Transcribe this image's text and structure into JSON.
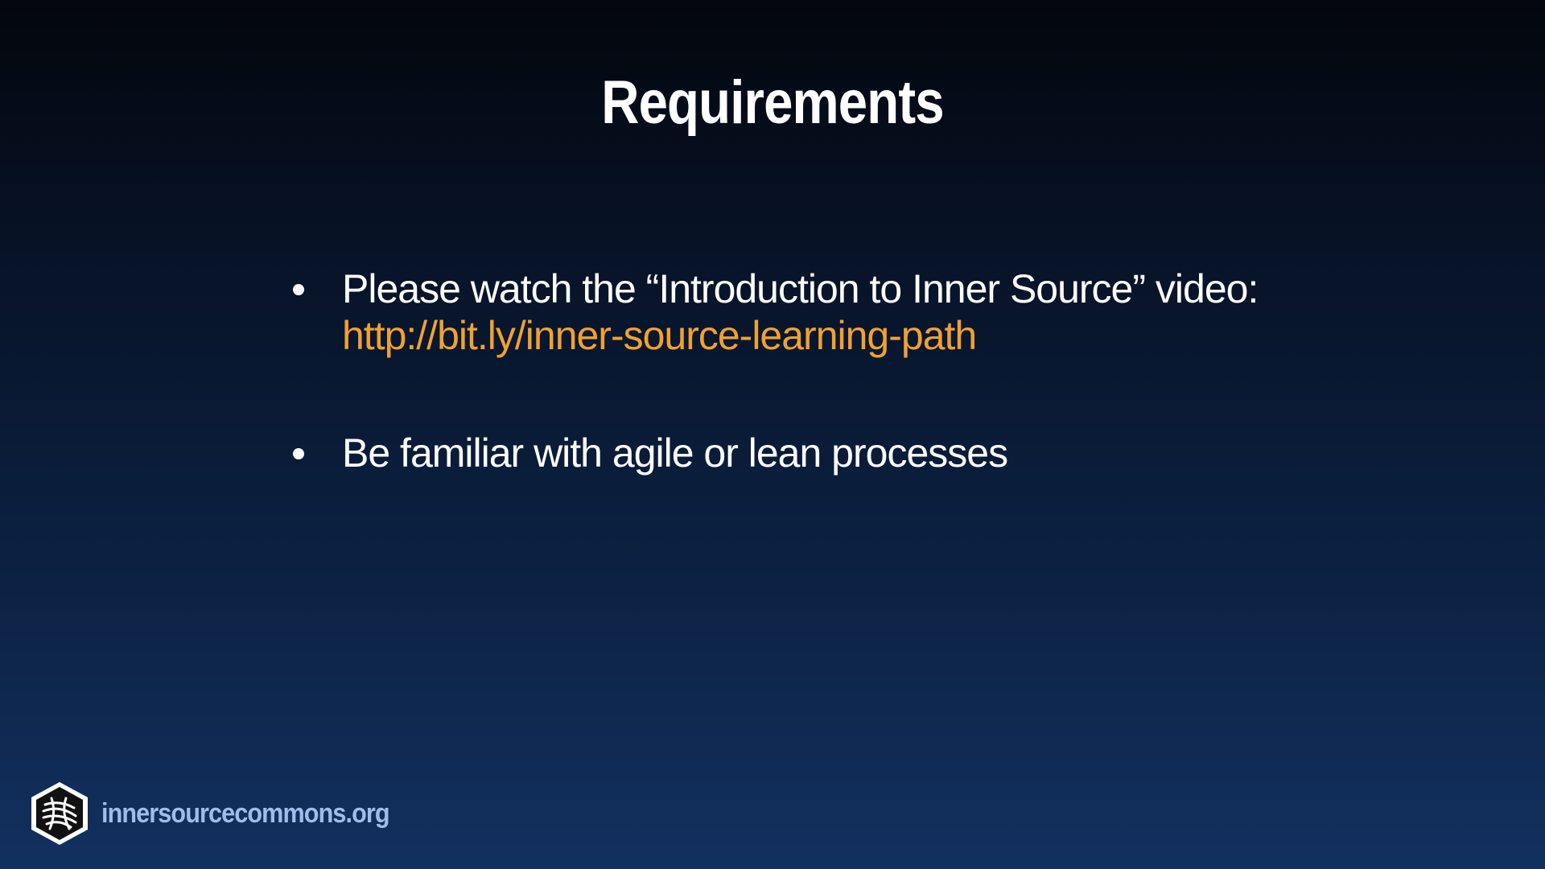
{
  "slide": {
    "title": "Requirements",
    "bullets": [
      {
        "text": "Please watch the “Introduction to Inner Source” video:",
        "link": "http://bit.ly/inner-source-learning-path"
      },
      {
        "text": "Be familiar with agile or lean processes"
      }
    ]
  },
  "footer": {
    "logo_icon": "innersource-commons-hexagon-logo-icon",
    "site": "innersourcecommons.org"
  },
  "colors": {
    "link": "#f2a12c",
    "footer_text": "#9fbdea",
    "background_top": "#03060c",
    "background_bottom": "#12305f"
  }
}
